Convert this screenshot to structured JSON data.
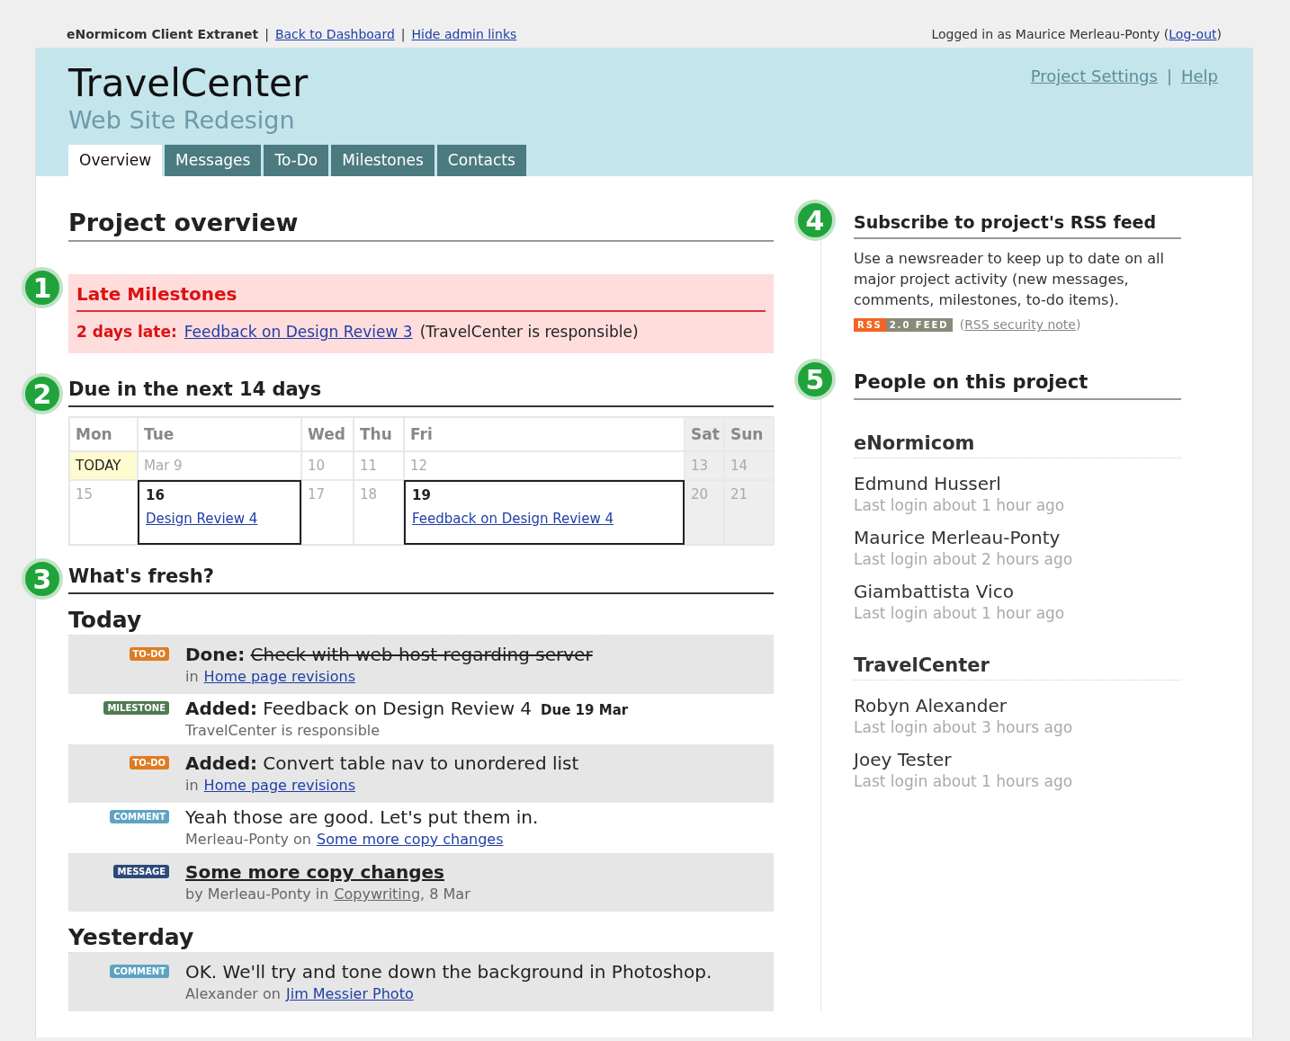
{
  "top_bar": {
    "site": "eNormicom Client Extranet",
    "separator": "|",
    "links": [
      "Back to Dashboard",
      "Hide admin links"
    ],
    "login_text": "Logged in as Maurice Merleau-Ponty (",
    "logout": "Log-out",
    "login_close": ")"
  },
  "header": {
    "title": "TravelCenter",
    "subtitle": "Web Site Redesign",
    "links": [
      "Project Settings",
      "Help"
    ],
    "separator": "|"
  },
  "tabs": [
    {
      "label": "Overview",
      "selected": true
    },
    {
      "label": "Messages",
      "selected": false
    },
    {
      "label": "To-Do",
      "selected": false
    },
    {
      "label": "Milestones",
      "selected": false
    },
    {
      "label": "Contacts",
      "selected": false
    }
  ],
  "overview": {
    "title": "Project overview",
    "late": {
      "marker": "1",
      "title": "Late Milestones",
      "items": [
        {
          "lateness": "2 days late:",
          "link": "Feedback on Design Review 3",
          "note": "(TravelCenter is responsible)"
        }
      ]
    },
    "due": {
      "marker": "2",
      "title": "Due in the next 14 days",
      "days": [
        {
          "label": "Mon",
          "weekend": false
        },
        {
          "label": "Tue",
          "weekend": false
        },
        {
          "label": "Wed",
          "weekend": false
        },
        {
          "label": "Thu",
          "weekend": false
        },
        {
          "label": "Fri",
          "weekend": false
        },
        {
          "label": "Sat",
          "weekend": true
        },
        {
          "label": "Sun",
          "weekend": true
        }
      ],
      "weeks": [
        [
          {
            "kind": "today",
            "text": "TODAY"
          },
          {
            "kind": "date",
            "text": "Mar 9"
          },
          {
            "kind": "date",
            "text": "10"
          },
          {
            "kind": "date",
            "text": "11"
          },
          {
            "kind": "date",
            "text": "12"
          },
          {
            "kind": "date",
            "text": "13"
          },
          {
            "kind": "date",
            "text": "14"
          }
        ],
        [
          {
            "kind": "date",
            "text": "15"
          },
          {
            "kind": "event",
            "text": "16",
            "link": "Design Review 4"
          },
          {
            "kind": "date",
            "text": "17"
          },
          {
            "kind": "date",
            "text": "18"
          },
          {
            "kind": "event",
            "text": "19",
            "link": "Feedback on Design Review 4"
          },
          {
            "kind": "date",
            "text": "20"
          },
          {
            "kind": "date",
            "text": "21"
          }
        ]
      ]
    },
    "fresh": {
      "marker": "3",
      "title": "What's fresh?",
      "groups": [
        {
          "heading": "Today",
          "items": [
            {
              "kind": "done",
              "badge": "TO-DO",
              "color": "#e07b22",
              "action": "Done:",
              "text": "Check with web host regarding server",
              "meta_prefix": "in",
              "meta_link": "Home page revisions"
            },
            {
              "kind": "added",
              "badge": "MILESTONE",
              "color": "#4f7a52",
              "action": "Added:",
              "text": "Feedback on Design Review 4",
              "due": "Due 19 Mar",
              "meta_prefix": "TravelCenter is responsible"
            },
            {
              "kind": "added",
              "badge": "TO-DO",
              "color": "#e07b22",
              "action": "Added:",
              "text": "Convert table nav to unordered list",
              "meta_prefix": "in",
              "meta_link": "Home page revisions"
            },
            {
              "kind": "comment",
              "badge": "COMMENT",
              "color": "#5ea4c2",
              "text": "Yeah those are good. Let's put them in.",
              "meta_prefix": "Merleau-Ponty on",
              "meta_link": "Some more copy changes"
            },
            {
              "kind": "message",
              "badge": "MESSAGE",
              "color": "#2c4a78",
              "text": "Some more copy changes",
              "meta_prefix": "by Merleau-Ponty in",
              "meta_link": "Copywriting",
              "meta_suffix": ", 8 Mar"
            }
          ]
        },
        {
          "heading": "Yesterday",
          "items": [
            {
              "kind": "comment",
              "badge": "COMMENT",
              "color": "#5ea4c2",
              "text": "OK. We'll try and tone down the background in Photoshop.",
              "meta_prefix": "Alexander on",
              "meta_link": "Jim Messier Photo"
            }
          ]
        }
      ]
    }
  },
  "sidebar": {
    "rss": {
      "marker": "4",
      "title": "Subscribe to project's RSS feed",
      "text": "Use a newsreader to keep up to date on all major project activity (new messages, comments, milestones, to-do items).",
      "badge_left": "RSS",
      "badge_right": "2.0 FEED",
      "note_open": "(",
      "note_link": "RSS security note",
      "note_close": ")"
    },
    "people": {
      "marker": "5",
      "title": "People on this project",
      "companies": [
        {
          "name": "eNormicom",
          "people": [
            {
              "name": "Edmund Husserl",
              "last_login": "Last login about 1 hour ago"
            },
            {
              "name": "Maurice Merleau-Ponty",
              "last_login": "Last login about 2 hours ago"
            },
            {
              "name": "Giambattista Vico",
              "last_login": "Last login about 1 hour ago"
            }
          ]
        },
        {
          "name": "TravelCenter",
          "people": [
            {
              "name": "Robyn Alexander",
              "last_login": "Last login about 3 hours ago"
            },
            {
              "name": "Joey Tester",
              "last_login": "Last login about 1 hours ago"
            }
          ]
        }
      ]
    }
  }
}
